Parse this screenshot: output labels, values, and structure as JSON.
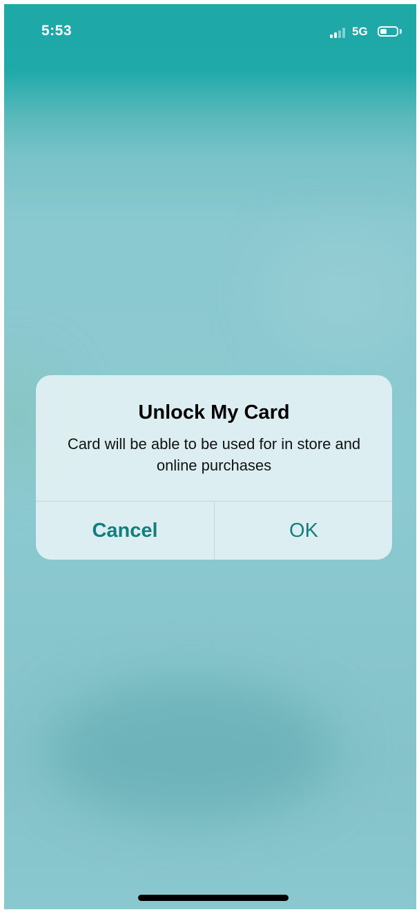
{
  "status_bar": {
    "time": "5:53",
    "network": "5G",
    "signal_bars_active": 2,
    "signal_bars_total": 4,
    "battery_level": 0.4,
    "icons": [
      "signal-icon",
      "battery-icon"
    ]
  },
  "alert": {
    "title": "Unlock My Card",
    "message": "Card will be able to be used for in store and online purchases",
    "cancel_label": "Cancel",
    "ok_label": "OK"
  },
  "colors": {
    "button_tint": "#127f7c",
    "background_top": "#1ea8a6",
    "background_main": "#8ccad1"
  }
}
